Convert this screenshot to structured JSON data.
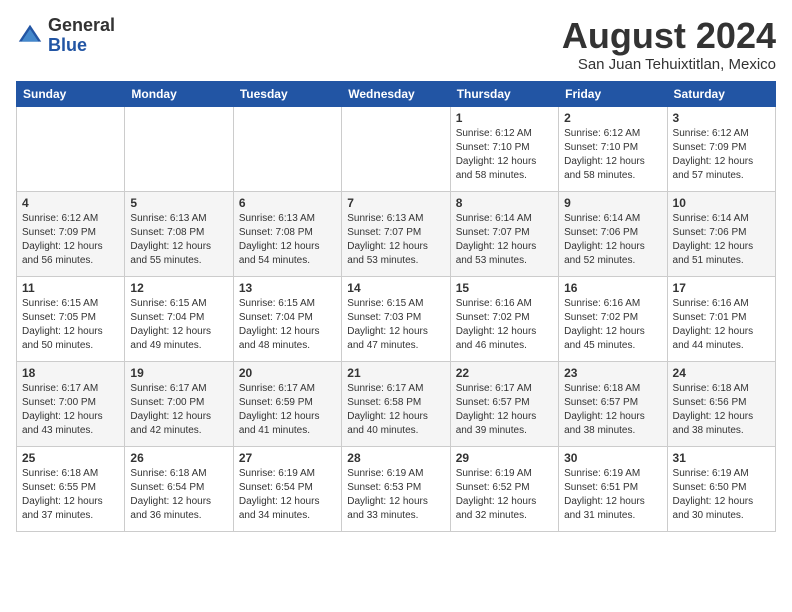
{
  "logo": {
    "general": "General",
    "blue": "Blue"
  },
  "header": {
    "month_year": "August 2024",
    "location": "San Juan Tehuixtitlan, Mexico"
  },
  "weekdays": [
    "Sunday",
    "Monday",
    "Tuesday",
    "Wednesday",
    "Thursday",
    "Friday",
    "Saturday"
  ],
  "weeks": [
    [
      {
        "day": "",
        "info": ""
      },
      {
        "day": "",
        "info": ""
      },
      {
        "day": "",
        "info": ""
      },
      {
        "day": "",
        "info": ""
      },
      {
        "day": "1",
        "info": "Sunrise: 6:12 AM\nSunset: 7:10 PM\nDaylight: 12 hours\nand 58 minutes."
      },
      {
        "day": "2",
        "info": "Sunrise: 6:12 AM\nSunset: 7:10 PM\nDaylight: 12 hours\nand 58 minutes."
      },
      {
        "day": "3",
        "info": "Sunrise: 6:12 AM\nSunset: 7:09 PM\nDaylight: 12 hours\nand 57 minutes."
      }
    ],
    [
      {
        "day": "4",
        "info": "Sunrise: 6:12 AM\nSunset: 7:09 PM\nDaylight: 12 hours\nand 56 minutes."
      },
      {
        "day": "5",
        "info": "Sunrise: 6:13 AM\nSunset: 7:08 PM\nDaylight: 12 hours\nand 55 minutes."
      },
      {
        "day": "6",
        "info": "Sunrise: 6:13 AM\nSunset: 7:08 PM\nDaylight: 12 hours\nand 54 minutes."
      },
      {
        "day": "7",
        "info": "Sunrise: 6:13 AM\nSunset: 7:07 PM\nDaylight: 12 hours\nand 53 minutes."
      },
      {
        "day": "8",
        "info": "Sunrise: 6:14 AM\nSunset: 7:07 PM\nDaylight: 12 hours\nand 53 minutes."
      },
      {
        "day": "9",
        "info": "Sunrise: 6:14 AM\nSunset: 7:06 PM\nDaylight: 12 hours\nand 52 minutes."
      },
      {
        "day": "10",
        "info": "Sunrise: 6:14 AM\nSunset: 7:06 PM\nDaylight: 12 hours\nand 51 minutes."
      }
    ],
    [
      {
        "day": "11",
        "info": "Sunrise: 6:15 AM\nSunset: 7:05 PM\nDaylight: 12 hours\nand 50 minutes."
      },
      {
        "day": "12",
        "info": "Sunrise: 6:15 AM\nSunset: 7:04 PM\nDaylight: 12 hours\nand 49 minutes."
      },
      {
        "day": "13",
        "info": "Sunrise: 6:15 AM\nSunset: 7:04 PM\nDaylight: 12 hours\nand 48 minutes."
      },
      {
        "day": "14",
        "info": "Sunrise: 6:15 AM\nSunset: 7:03 PM\nDaylight: 12 hours\nand 47 minutes."
      },
      {
        "day": "15",
        "info": "Sunrise: 6:16 AM\nSunset: 7:02 PM\nDaylight: 12 hours\nand 46 minutes."
      },
      {
        "day": "16",
        "info": "Sunrise: 6:16 AM\nSunset: 7:02 PM\nDaylight: 12 hours\nand 45 minutes."
      },
      {
        "day": "17",
        "info": "Sunrise: 6:16 AM\nSunset: 7:01 PM\nDaylight: 12 hours\nand 44 minutes."
      }
    ],
    [
      {
        "day": "18",
        "info": "Sunrise: 6:17 AM\nSunset: 7:00 PM\nDaylight: 12 hours\nand 43 minutes."
      },
      {
        "day": "19",
        "info": "Sunrise: 6:17 AM\nSunset: 7:00 PM\nDaylight: 12 hours\nand 42 minutes."
      },
      {
        "day": "20",
        "info": "Sunrise: 6:17 AM\nSunset: 6:59 PM\nDaylight: 12 hours\nand 41 minutes."
      },
      {
        "day": "21",
        "info": "Sunrise: 6:17 AM\nSunset: 6:58 PM\nDaylight: 12 hours\nand 40 minutes."
      },
      {
        "day": "22",
        "info": "Sunrise: 6:17 AM\nSunset: 6:57 PM\nDaylight: 12 hours\nand 39 minutes."
      },
      {
        "day": "23",
        "info": "Sunrise: 6:18 AM\nSunset: 6:57 PM\nDaylight: 12 hours\nand 38 minutes."
      },
      {
        "day": "24",
        "info": "Sunrise: 6:18 AM\nSunset: 6:56 PM\nDaylight: 12 hours\nand 38 minutes."
      }
    ],
    [
      {
        "day": "25",
        "info": "Sunrise: 6:18 AM\nSunset: 6:55 PM\nDaylight: 12 hours\nand 37 minutes."
      },
      {
        "day": "26",
        "info": "Sunrise: 6:18 AM\nSunset: 6:54 PM\nDaylight: 12 hours\nand 36 minutes."
      },
      {
        "day": "27",
        "info": "Sunrise: 6:19 AM\nSunset: 6:54 PM\nDaylight: 12 hours\nand 34 minutes."
      },
      {
        "day": "28",
        "info": "Sunrise: 6:19 AM\nSunset: 6:53 PM\nDaylight: 12 hours\nand 33 minutes."
      },
      {
        "day": "29",
        "info": "Sunrise: 6:19 AM\nSunset: 6:52 PM\nDaylight: 12 hours\nand 32 minutes."
      },
      {
        "day": "30",
        "info": "Sunrise: 6:19 AM\nSunset: 6:51 PM\nDaylight: 12 hours\nand 31 minutes."
      },
      {
        "day": "31",
        "info": "Sunrise: 6:19 AM\nSunset: 6:50 PM\nDaylight: 12 hours\nand 30 minutes."
      }
    ]
  ]
}
